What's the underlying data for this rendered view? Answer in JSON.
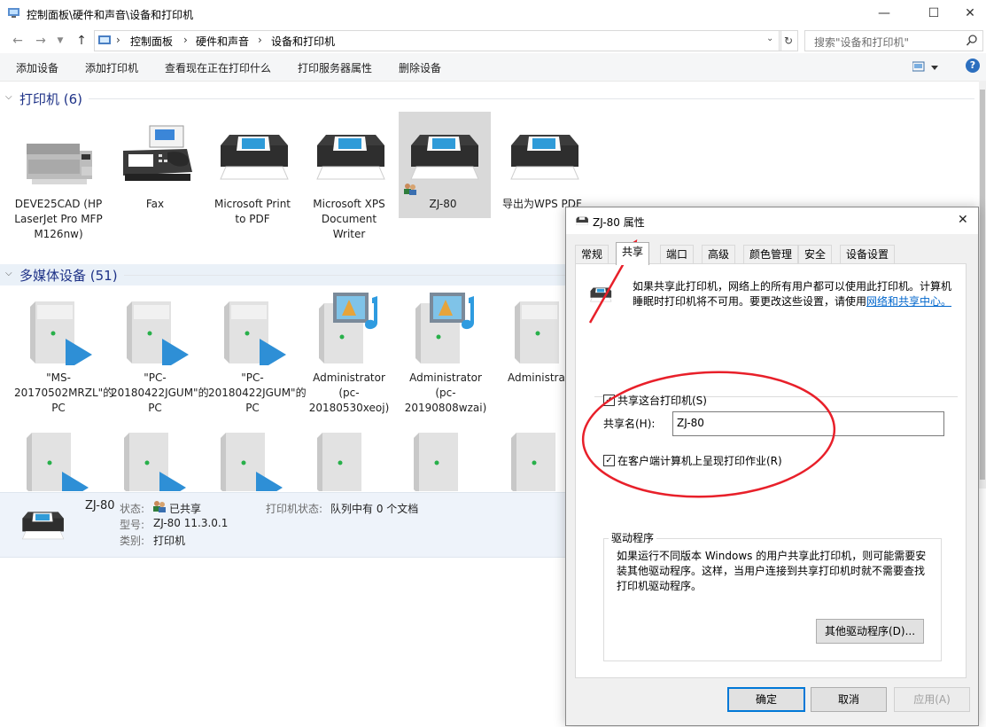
{
  "window": {
    "title": "控制面板\\硬件和声音\\设备和打印机",
    "minimize": "—",
    "maximize": "☐",
    "close": "✕"
  },
  "address": {
    "crumbs": [
      "控制面板",
      "硬件和声音",
      "设备和打印机"
    ],
    "search_placeholder": "搜索\"设备和打印机\""
  },
  "commands": [
    "添加设备",
    "添加打印机",
    "查看现在正在打印什么",
    "打印服务器属性",
    "删除设备"
  ],
  "printers_group": {
    "label": "打印机 (6)",
    "items": [
      {
        "name": "DEVE25CAD (HP LaserJet Pro MFP M126nw)",
        "icon": "laser-printer-icon"
      },
      {
        "name": "Fax",
        "icon": "fax-icon"
      },
      {
        "name": "Microsoft Print to PDF",
        "icon": "printer-icon"
      },
      {
        "name": "Microsoft XPS Document Writer",
        "icon": "printer-icon"
      },
      {
        "name": "ZJ-80",
        "icon": "printer-icon"
      },
      {
        "name": "导出为WPS PDF",
        "icon": "printer-icon"
      }
    ]
  },
  "media_group": {
    "label": "多媒体设备 (51)",
    "items": [
      {
        "name": "\"MS-20170502MRZL\"的PC",
        "icon": "media-server-icon"
      },
      {
        "name": "\"PC-20180422JGUM\"的PC",
        "icon": "media-server-icon"
      },
      {
        "name": "\"PC-20180422JGUM\"的PC",
        "icon": "media-server-icon"
      },
      {
        "name": "Administrator (pc-20180530xeoj)",
        "icon": "media-library-icon"
      },
      {
        "name": "Administrator (pc-20190808wzai)",
        "icon": "media-library-icon"
      },
      {
        "name": "Administrator的恒星播放器",
        "icon": "media-server-icon"
      }
    ]
  },
  "details": {
    "name": "ZJ-80",
    "status_label": "状态:",
    "status_value": "已共享",
    "model_label": "型号:",
    "model_value": "ZJ-80 11.3.0.1",
    "category_label": "类别:",
    "category_value": "打印机",
    "printer_status_label": "打印机状态:",
    "printer_status_value": "队列中有 0 个文档"
  },
  "dialog": {
    "title": "ZJ-80 属性",
    "tabs": [
      "常规",
      "共享",
      "端口",
      "高级",
      "颜色管理",
      "安全",
      "设备设置"
    ],
    "active_tab": "共享",
    "info_text": "如果共享此打印机，网络上的所有用户都可以使用此打印机。计算机睡眠时打印机将不可用。要更改这些设置，请使用",
    "info_link": "网络和共享中心。",
    "share_checkbox": "共享这台打印机(S)",
    "share_checked": true,
    "share_name_label": "共享名(H):",
    "share_name_value": "ZJ-80",
    "render_checkbox": "在客户端计算机上呈现打印作业(R)",
    "render_checked": true,
    "drivers_group_label": "驱动程序",
    "drivers_text": "如果运行不同版本 Windows 的用户共享此打印机，则可能需要安装其他驱动程序。这样，当用户连接到共享打印机时就不需要查找打印机驱动程序。",
    "other_drivers_button": "其他驱动程序(D)...",
    "ok_button": "确定",
    "cancel_button": "取消",
    "apply_button": "应用(A)"
  },
  "colors": {
    "annotation_red": "#e8202a",
    "selection": "#d9d9d9",
    "link": "#0066cc",
    "group_header": "#1e3287"
  }
}
